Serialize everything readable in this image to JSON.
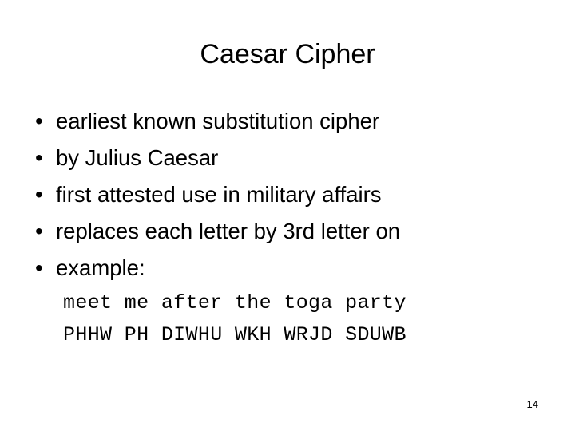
{
  "slide": {
    "title": "Caesar Cipher",
    "page_number": "14",
    "background_color": "#ffffff",
    "text_color": "#000000",
    "bullet_marker": "•",
    "bullets": [
      {
        "text": "earliest known substitution cipher"
      },
      {
        "text": "by Julius Caesar"
      },
      {
        "text": "first attested use in military affairs"
      },
      {
        "text": "replaces each letter by 3rd letter on"
      },
      {
        "text": "example:"
      }
    ],
    "example": {
      "plaintext": "meet me after the toga party",
      "ciphertext": "PHHW PH DIWHU WKH WRJD SDUWB"
    }
  }
}
